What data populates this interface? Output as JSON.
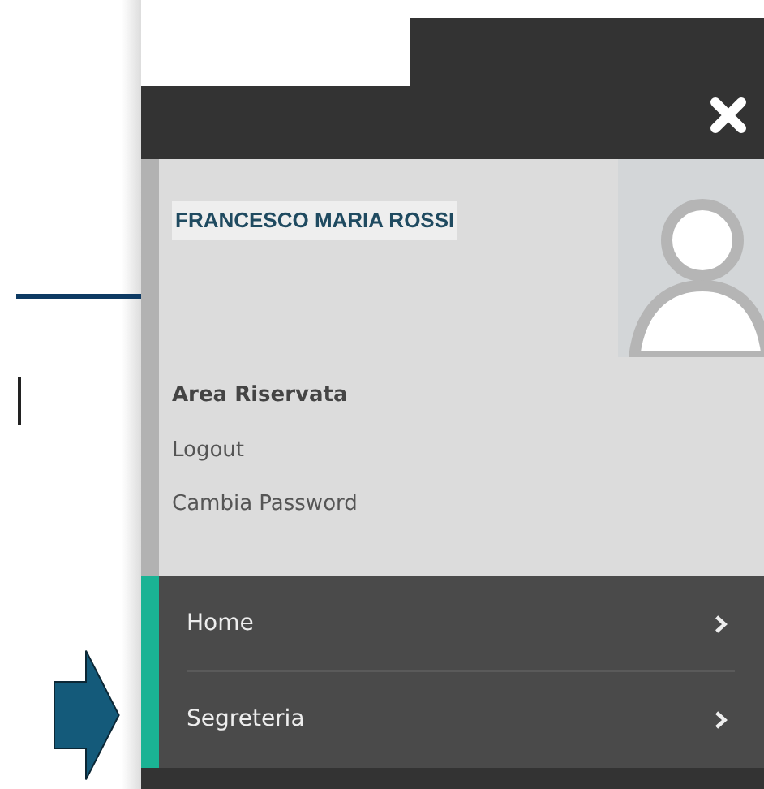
{
  "profile": {
    "name": "FRANCESCO MARIA ROSSI"
  },
  "account": {
    "title": "Area Riservata",
    "links": [
      "Logout",
      "Cambia Password"
    ]
  },
  "menu": [
    {
      "label": "Home"
    },
    {
      "label": "Segreteria"
    }
  ]
}
